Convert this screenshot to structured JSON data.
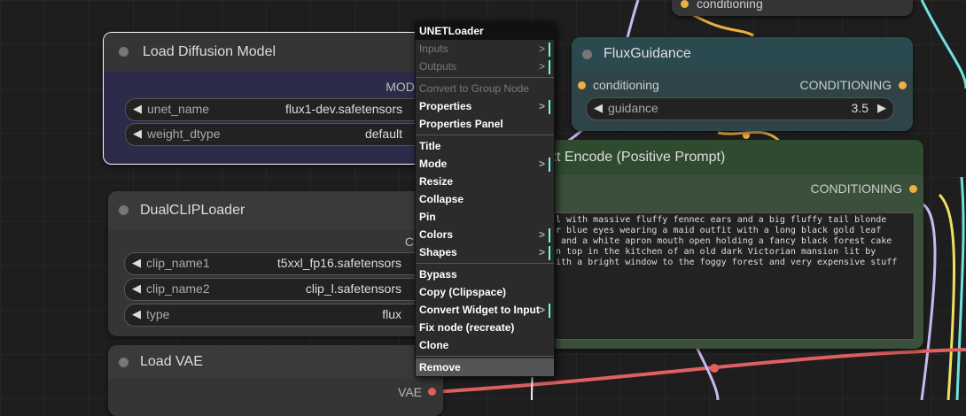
{
  "nodes": {
    "load_diffusion": {
      "title": "Load Diffusion Model",
      "output": "MODEL",
      "widgets": [
        {
          "name": "unet_name",
          "value": "flux1-dev.safetensors"
        },
        {
          "name": "weight_dtype",
          "value": "default"
        }
      ]
    },
    "dual_clip": {
      "title": "DualCLIPLoader",
      "output": "CLIP",
      "widgets": [
        {
          "name": "clip_name1",
          "value": "t5xxl_fp16.safetensors"
        },
        {
          "name": "clip_name2",
          "value": "clip_l.safetensors"
        },
        {
          "name": "type",
          "value": "flux"
        }
      ]
    },
    "load_vae": {
      "title": "Load VAE",
      "output": "VAE"
    },
    "flux_guidance": {
      "title": "FluxGuidance",
      "input": "conditioning",
      "output": "CONDITIONING",
      "widget": {
        "name": "guidance",
        "value": "3.5"
      }
    },
    "text_encode": {
      "title": "xt Encode (Positive Prompt)",
      "output": "CONDITIONING",
      "prompt": "l with massive fluffy fennec ears and a big fluffy tail blonde\nr blue eyes wearing a maid outfit with a long black gold leaf\n and a white apron mouth open holding a fancy black forest cake\nn top in the kitchen of an old dark Victorian mansion lit by\nith a bright window to the foggy forest and very expensive stuff"
    },
    "top_node": {
      "input": "conditioning"
    }
  },
  "context_menu": {
    "header": "UNETLoader",
    "items": [
      {
        "label": "Inputs",
        "disabled": true,
        "submenu": true
      },
      {
        "label": "Outputs",
        "disabled": true,
        "submenu": true
      },
      {
        "sep": true
      },
      {
        "label": "Convert to Group Node",
        "disabled": true
      },
      {
        "label": "Properties",
        "submenu": true
      },
      {
        "label": "Properties Panel"
      },
      {
        "sep": true
      },
      {
        "label": "Title"
      },
      {
        "label": "Mode",
        "submenu": true
      },
      {
        "label": "Resize"
      },
      {
        "label": "Collapse"
      },
      {
        "label": "Pin"
      },
      {
        "label": "Colors",
        "submenu": true
      },
      {
        "label": "Shapes",
        "submenu": true
      },
      {
        "sep": true
      },
      {
        "label": "Bypass"
      },
      {
        "label": "Copy (Clipspace)"
      },
      {
        "label": "Convert Widget to Input",
        "submenu": true
      },
      {
        "label": "Fix node (recreate)"
      },
      {
        "label": "Clone"
      },
      {
        "sep": true
      },
      {
        "label": "Remove",
        "selected": true
      }
    ]
  },
  "colors": {
    "selected_node_border": "#ffffff",
    "load_diffusion_bg": "#2c2c4a",
    "flux_guidance_title": "#2a4a50",
    "text_encode_title": "#2f4a2f",
    "wire_vae": "#e06060",
    "wire_conditioning": "#f0b040",
    "wire_model": "#b0a0e0",
    "wire_clip": "#f0e060",
    "wire_latent": "#70e0e0"
  }
}
